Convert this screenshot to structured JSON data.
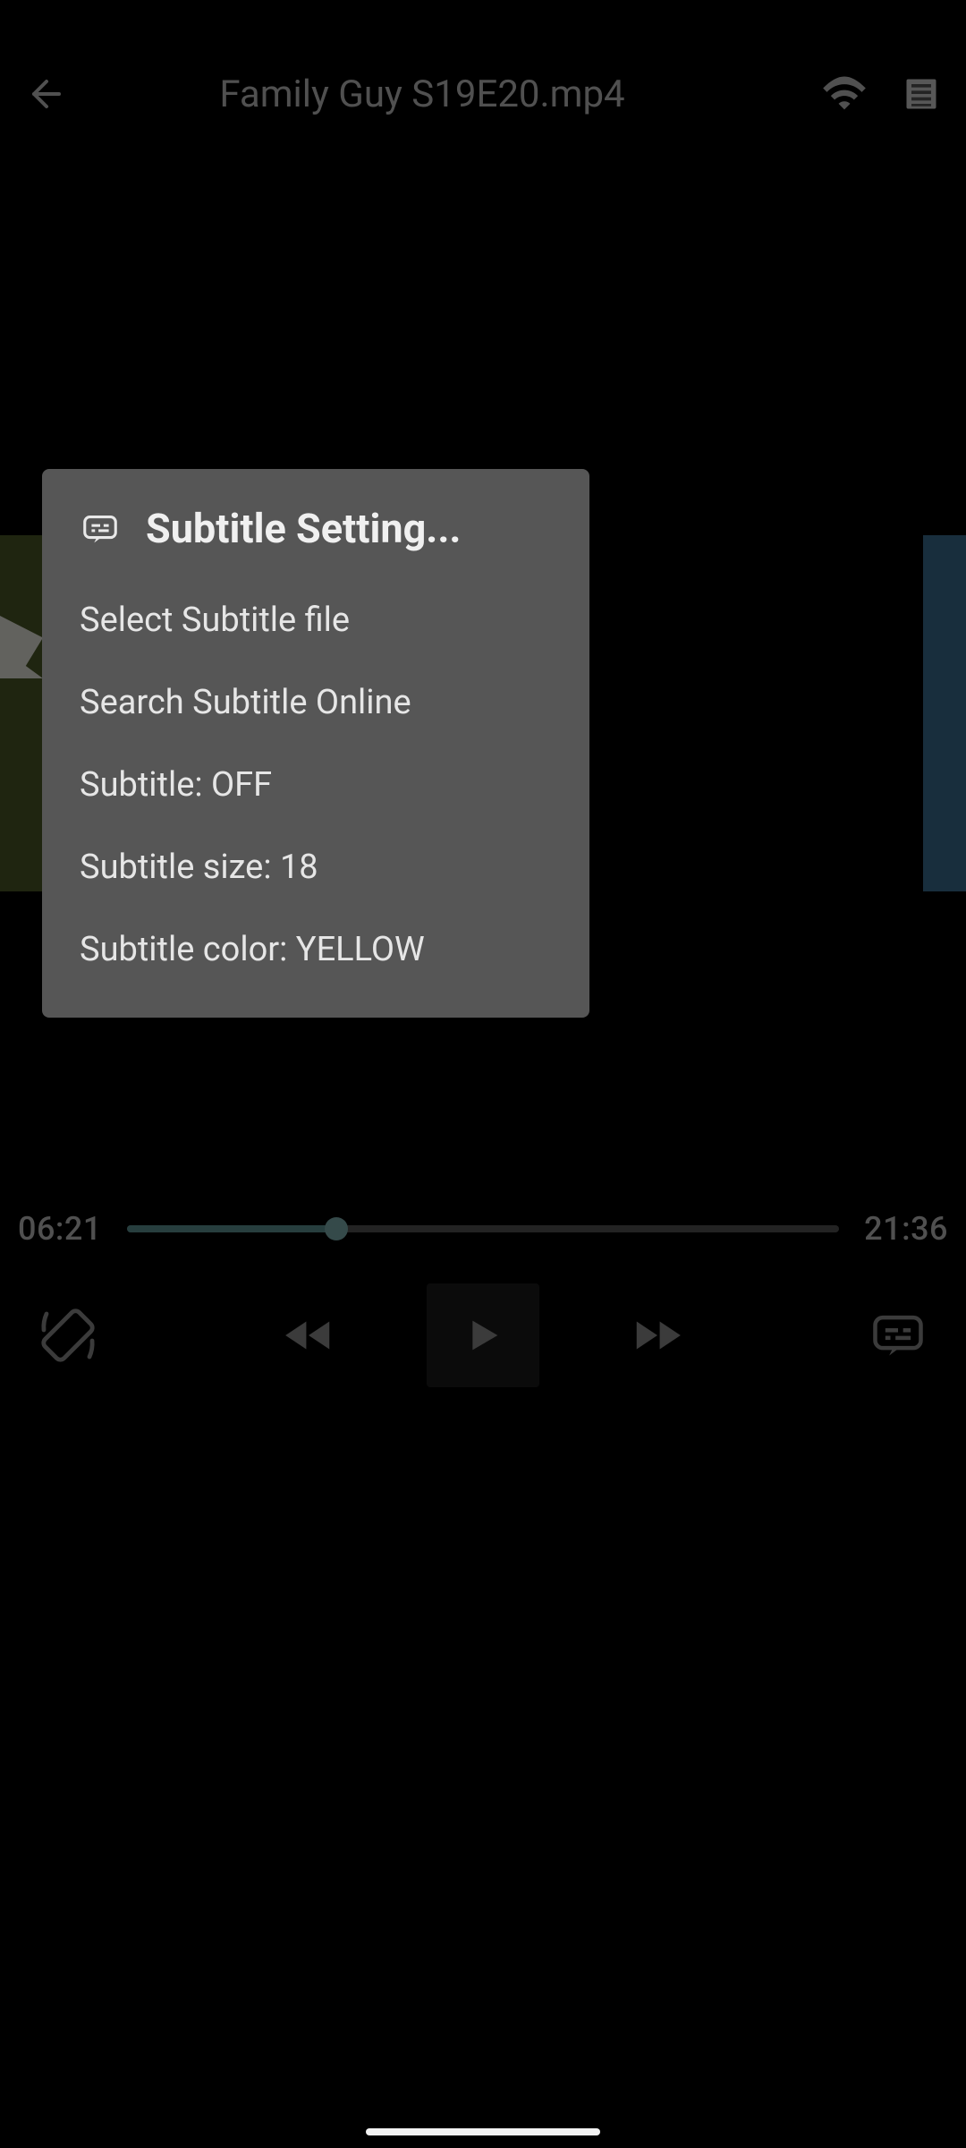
{
  "header": {
    "title": "Family Guy S19E20.mp4"
  },
  "player": {
    "current_time": "06:21",
    "total_time": "21:36"
  },
  "dialog": {
    "title": "Subtitle Setting...",
    "items": {
      "select_file": "Select Subtitle file",
      "search_online": "Search Subtitle Online",
      "toggle": "Subtitle: OFF",
      "size": "Subtitle size: 18",
      "color": "Subtitle color: YELLOW"
    }
  }
}
